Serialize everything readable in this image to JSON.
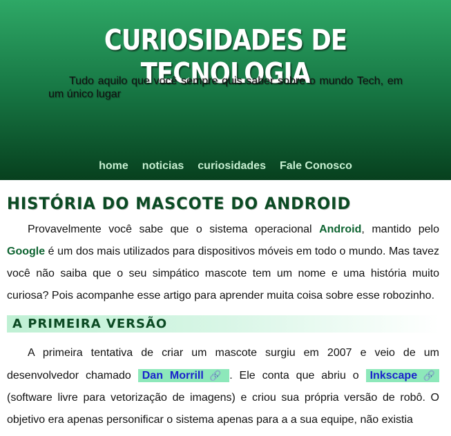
{
  "header": {
    "title": "CURIOSIDADES DE TECNOLOGIA",
    "subtitle": "Tudo aquilo que você sempre quis saber sobre o mundo Tech, em um único lugar"
  },
  "nav": {
    "items": [
      "home",
      "noticias",
      "curiosidades",
      "Fale Conosco"
    ]
  },
  "article": {
    "title": "História do mascote do Android",
    "intro": {
      "t1": "Provavelmente você sabe que o sistema operacional ",
      "android": "Android",
      "t2": ", mantido pelo ",
      "google": "Google",
      "t3": " é um dos mais utilizados para dispositivos móveis em todo o mundo. Mas tavez você não saiba que o seu simpático mascote tem um nome e uma história muito curiosa? Pois acompanhe esse artigo para aprender muita coisa sobre esse robozinho."
    },
    "section1": {
      "title": "A primeira versão",
      "t1": "A primeira tentativa de criar um mascote surgiu em 2007 e veio de um desenvolvedor chamado ",
      "link1": "Dan Morrill",
      "t2": ". Ele conta que abriu o ",
      "link2": "Inkscape",
      "t3": " (software livre para vetorização de imagens) e criou sua própria versão de robô. O objetivo era apenas personificar o sistema apenas para a a sua equipe, não existia"
    },
    "link_icon": "🔗"
  },
  "colors": {
    "header_top": "#2ea866",
    "header_bottom": "#07401e",
    "accent": "#0d6330",
    "link_bg": "#8de8ba",
    "link_text": "#1a22cc"
  }
}
